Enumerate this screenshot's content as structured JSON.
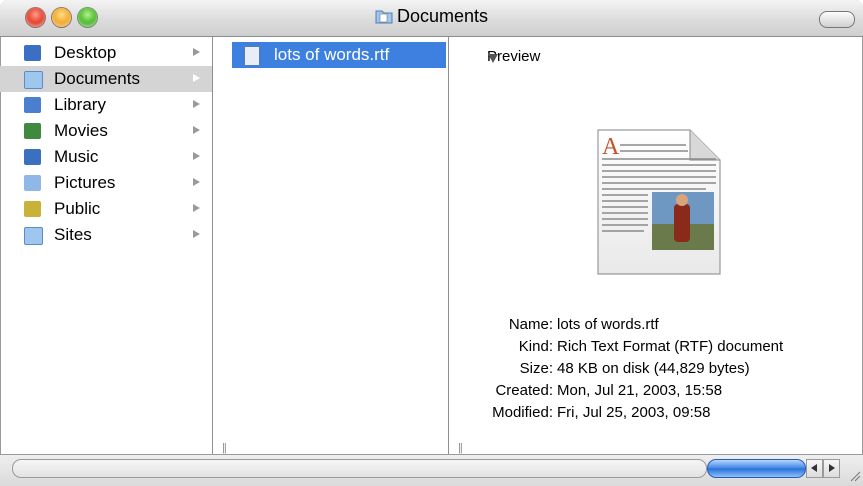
{
  "window": {
    "title": "Documents"
  },
  "sidebar": {
    "items": [
      {
        "label": "Desktop",
        "icon": "desktop-folder-icon",
        "color": "#3a6fc4"
      },
      {
        "label": "Documents",
        "icon": "documents-folder-icon",
        "color": "#9fc6ee"
      },
      {
        "label": "Library",
        "icon": "library-folder-icon",
        "color": "#4a7fd0"
      },
      {
        "label": "Movies",
        "icon": "movies-folder-icon",
        "color": "#3f8a3f"
      },
      {
        "label": "Music",
        "icon": "music-folder-icon",
        "color": "#3b6fc0"
      },
      {
        "label": "Pictures",
        "icon": "pictures-folder-icon",
        "color": "#8fb8e6"
      },
      {
        "label": "Public",
        "icon": "public-folder-icon",
        "color": "#c8b23a"
      },
      {
        "label": "Sites",
        "icon": "sites-folder-icon",
        "color": "#9fc6ee"
      }
    ],
    "selected_index": 1
  },
  "files": {
    "items": [
      {
        "label": "lots of words.rtf",
        "icon": "rtf-document-icon"
      }
    ]
  },
  "preview": {
    "header": "Preview",
    "info": [
      {
        "key": "Name:",
        "value": "lots of words.rtf"
      },
      {
        "key": "Kind:",
        "value": "Rich Text Format (RTF) document"
      },
      {
        "key": "Size:",
        "value": "48 KB on disk (44,829 bytes)"
      },
      {
        "key": "Created:",
        "value": "Mon, Jul 21, 2003, 15:58"
      },
      {
        "key": "Modified:",
        "value": "Fri, Jul 25, 2003, 09:58"
      }
    ]
  },
  "colors": {
    "selection": "#3d80df",
    "sidebar_selection": "#d4d4d4"
  }
}
